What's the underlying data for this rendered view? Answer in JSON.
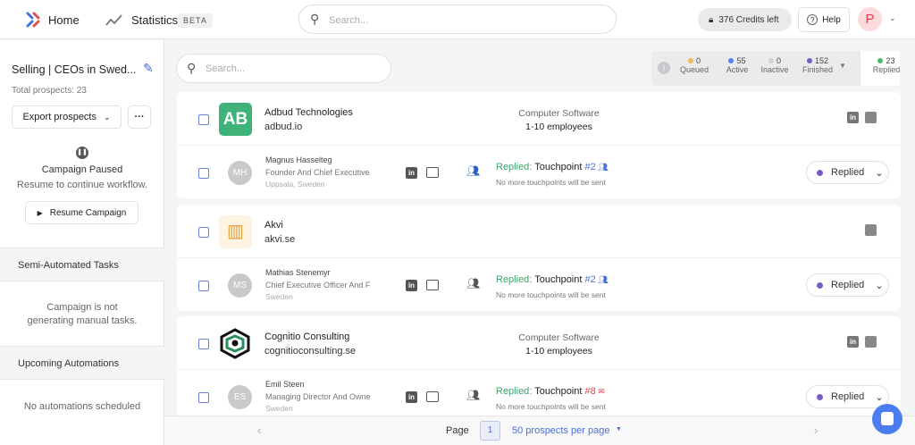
{
  "header": {
    "home": "Home",
    "statistics": "Statistics",
    "beta": "BETA",
    "search_placeholder": "Search...",
    "credits": "376 Credits left",
    "help": "Help",
    "avatar": "P"
  },
  "sidebar": {
    "campaign_title": "Selling | CEOs in Swed...",
    "total": "Total prospects: 23",
    "export": "Export prospects",
    "paused": "Campaign Paused",
    "resume_hint": "Resume to continue workflow.",
    "resume": "Resume Campaign",
    "semi_title": "Semi-Automated Tasks",
    "semi_msg_1": "Campaign is not",
    "semi_msg_2": "generating manual tasks.",
    "upcoming_title": "Upcoming Automations",
    "upcoming_msg": "No automations scheduled"
  },
  "main": {
    "search_placeholder": "Search...",
    "stats": [
      {
        "n": "0",
        "label": "Queued",
        "color": "#f0b95a"
      },
      {
        "n": "55",
        "label": "Active",
        "color": "#5b7ff0"
      },
      {
        "n": "0",
        "label": "Inactive",
        "color": "#cfd0d3"
      },
      {
        "n": "152",
        "label": "Finished",
        "color": "#7a5cc4"
      },
      {
        "n": "23",
        "label": "Replied",
        "color": "#47b96e"
      }
    ],
    "companies": [
      {
        "name": "Adbud Technologies",
        "domain": "adbud.io",
        "industry": "Computer Software",
        "employees": "1-10 employees",
        "logo": "AB",
        "prospect": {
          "initials": "MH",
          "name": "Magnus Hasselteg",
          "title": "Founder And Chief Executive",
          "location": "Uppsala, Sweden",
          "replied": "Replied:",
          "touchpoint": "Touchpoint",
          "tp_num": "#2",
          "note": "No more touchpoints will be sent",
          "status": "Replied"
        }
      },
      {
        "name": "Akvi",
        "domain": "akvi.se",
        "industry": "",
        "employees": "",
        "logo": "",
        "prospect": {
          "initials": "MS",
          "name": "Mathias Stenemyr",
          "title": "Chief Executive Officer And F",
          "location": "Sweden",
          "replied": "Replied:",
          "touchpoint": "Touchpoint",
          "tp_num": "#2",
          "note": "No more touchpoints will be sent",
          "status": "Replied"
        }
      },
      {
        "name": "Cognitio Consulting",
        "domain": "cognitioconsulting.se",
        "industry": "Computer Software",
        "employees": "1-10 employees",
        "logo": "",
        "prospect": {
          "initials": "ES",
          "name": "Emil Steen",
          "title": "Managing Director And Owne",
          "location": "Sweden",
          "replied": "Replied:",
          "touchpoint": "Touchpoint",
          "tp_num": "#8",
          "note": "No more touchpoints will be sent",
          "status": "Replied"
        }
      }
    ],
    "footer": {
      "page_label": "Page",
      "page": "1",
      "per_page": "50 prospects per page"
    }
  }
}
